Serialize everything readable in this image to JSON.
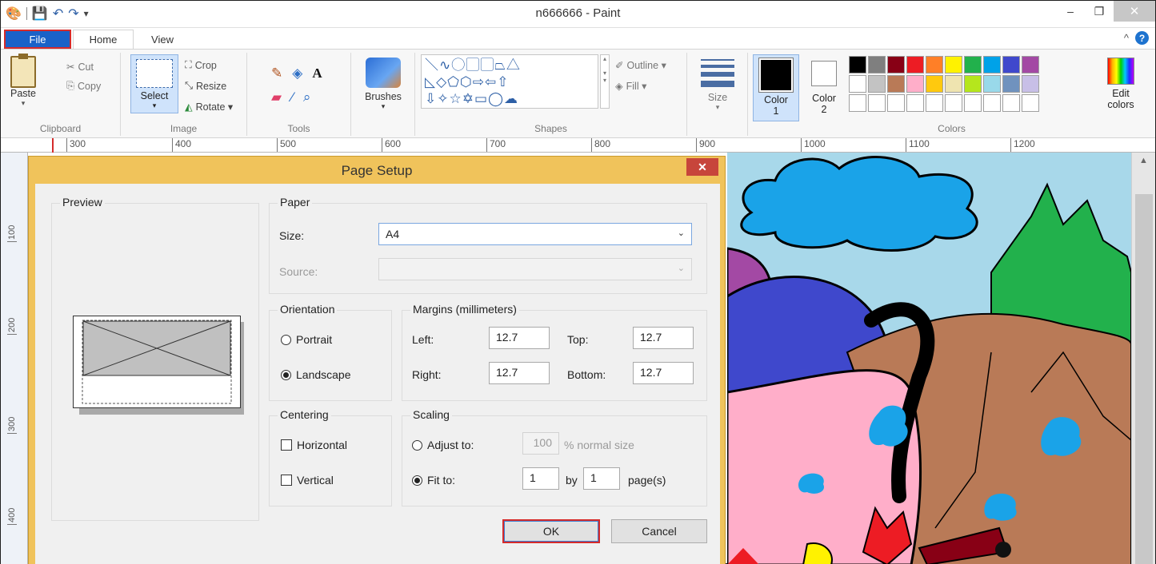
{
  "window": {
    "title": "n666666 - Paint",
    "minimize_glyph": "–",
    "restore_glyph": "❐",
    "close_glyph": "✕"
  },
  "tabs": {
    "file": "File",
    "home": "Home",
    "view": "View"
  },
  "ribbon": {
    "clipboard": {
      "label": "Clipboard",
      "paste": "Paste",
      "cut": "Cut",
      "copy": "Copy"
    },
    "image": {
      "label": "Image",
      "select": "Select",
      "crop": "Crop",
      "resize": "Resize",
      "rotate": "Rotate ▾"
    },
    "tools": {
      "label": "Tools"
    },
    "brushes": {
      "label": "Brushes"
    },
    "shapes": {
      "label": "Shapes",
      "outline": "Outline ▾",
      "fill": "Fill ▾"
    },
    "size": {
      "label": "Size"
    },
    "colors": {
      "label": "Colors",
      "color1": "Color 1",
      "color2": "Color 2",
      "edit": "Edit colors",
      "palette": [
        "#000000",
        "#7f7f7f",
        "#880015",
        "#ed1c24",
        "#ff7f27",
        "#fff200",
        "#22b14c",
        "#00a2e8",
        "#3f48cc",
        "#a349a4",
        "#ffffff",
        "#c3c3c3",
        "#b97a57",
        "#ffaec9",
        "#ffc90e",
        "#efe4b0",
        "#b5e61d",
        "#99d9ea",
        "#7092be",
        "#c8bfe7",
        "#ffffff",
        "#ffffff",
        "#ffffff",
        "#ffffff",
        "#ffffff",
        "#ffffff",
        "#ffffff",
        "#ffffff",
        "#ffffff",
        "#ffffff"
      ]
    }
  },
  "ruler": {
    "h_marks": [
      "300",
      "400",
      "500",
      "600",
      "700",
      "800",
      "900",
      "1000",
      "1100",
      "1200"
    ],
    "v_marks": [
      "100",
      "200",
      "300",
      "400"
    ]
  },
  "dialog": {
    "title": "Page Setup",
    "preview_label": "Preview",
    "paper": {
      "label": "Paper",
      "size_label": "Size:",
      "size_value": "A4",
      "source_label": "Source:",
      "source_value": ""
    },
    "orientation": {
      "label": "Orientation",
      "portrait": "Portrait",
      "landscape": "Landscape",
      "selected": "Landscape"
    },
    "margins": {
      "label": "Margins (millimeters)",
      "left_label": "Left:",
      "left": "12.7",
      "top_label": "Top:",
      "top": "12.7",
      "right_label": "Right:",
      "right": "12.7",
      "bottom_label": "Bottom:",
      "bottom": "12.7"
    },
    "centering": {
      "label": "Centering",
      "horizontal": "Horizontal",
      "vertical": "Vertical"
    },
    "scaling": {
      "label": "Scaling",
      "adjust_label": "Adjust to:",
      "adjust_value": "100",
      "adjust_suffix": "% normal size",
      "fit_label": "Fit to:",
      "fit_w": "1",
      "by": "by",
      "fit_h": "1",
      "pages": "page(s)",
      "selected": "Fit to"
    },
    "ok": "OK",
    "cancel": "Cancel"
  }
}
